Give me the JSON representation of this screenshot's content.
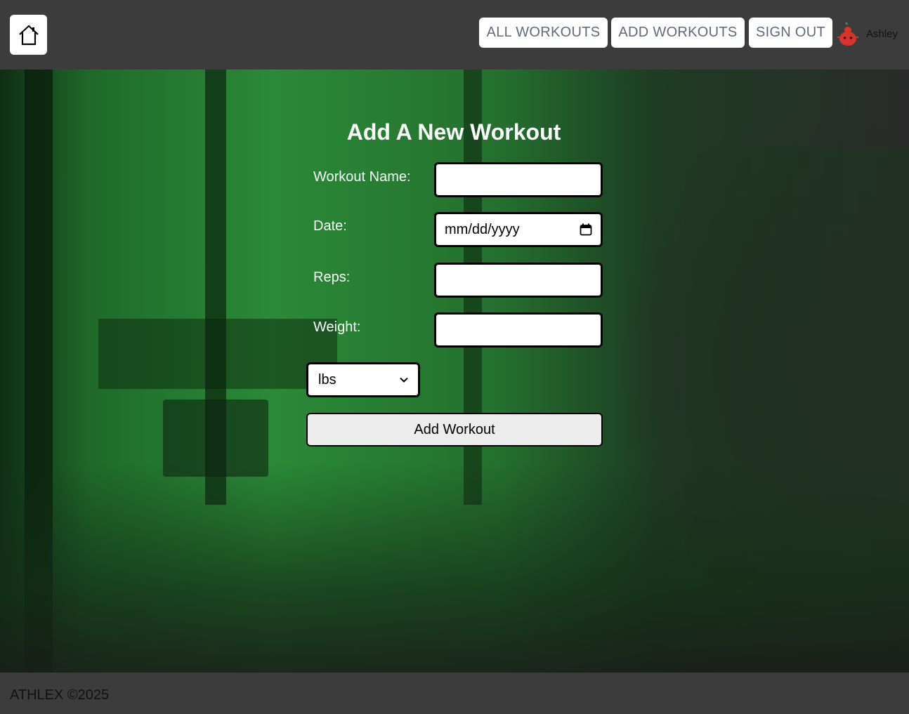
{
  "header": {
    "nav": {
      "all_workouts": "ALL WORKOUTS",
      "add_workouts": "ADD WORKOUTS",
      "sign_out": "SIGN OUT"
    },
    "username": "Ashley"
  },
  "form": {
    "title": "Add A New Workout",
    "fields": {
      "workout_name": {
        "label": "Workout Name:",
        "value": ""
      },
      "date": {
        "label": "Date:",
        "placeholder": "mm/dd/yyyy"
      },
      "reps": {
        "label": "Reps:",
        "value": ""
      },
      "weight": {
        "label": "Weight:",
        "value": ""
      }
    },
    "unit_select": {
      "selected": "lbs"
    },
    "submit_label": "Add Workout"
  },
  "footer": {
    "text": "ATHLEX ©2025"
  },
  "colors": {
    "header_bg": "#3d3c3d",
    "nav_text": "#5f6b7a",
    "hero_green": "#2a8a37",
    "avatar_red": "#d9332b"
  },
  "icons": {
    "home": "home-icon",
    "avatar": "avatar-icon",
    "calendar": "calendar-icon",
    "dropdown": "chevron-down-icon"
  }
}
